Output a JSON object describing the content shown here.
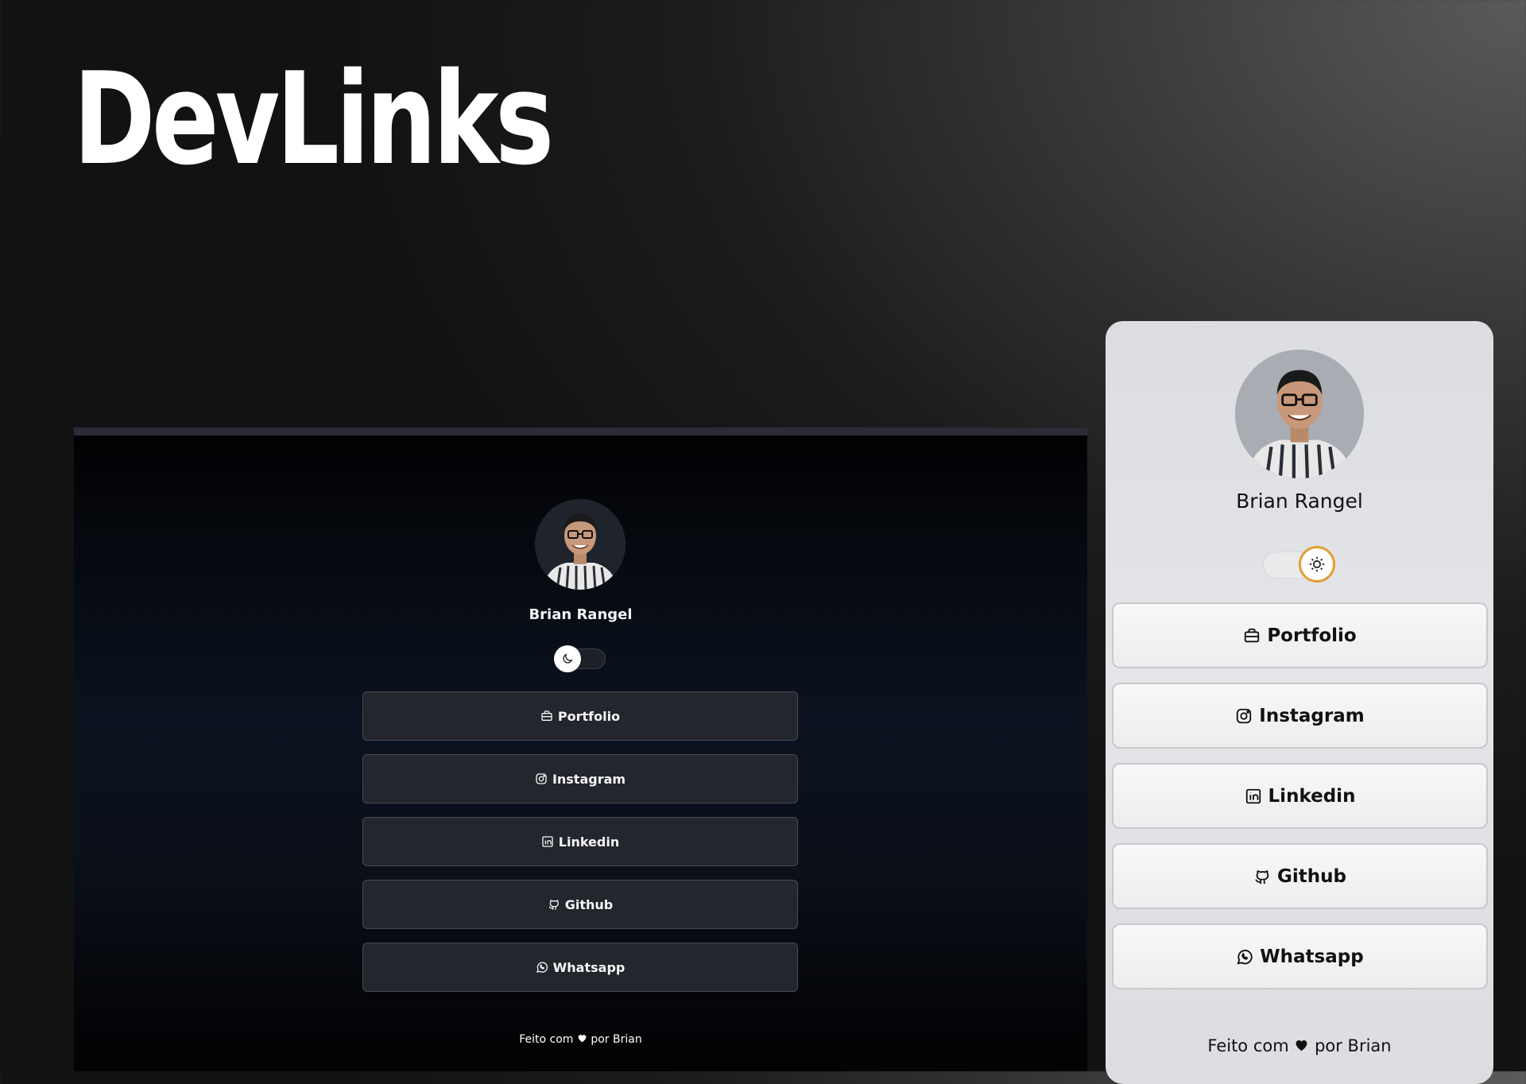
{
  "hero": {
    "title": "DevLinks"
  },
  "profile": {
    "name": "Brian Rangel"
  },
  "links": [
    {
      "label": "Portfolio",
      "icon": "briefcase-icon"
    },
    {
      "label": "Instagram",
      "icon": "instagram-icon"
    },
    {
      "label": "Linkedin",
      "icon": "linkedin-icon"
    },
    {
      "label": "Github",
      "icon": "github-icon"
    },
    {
      "label": "Whatsapp",
      "icon": "whatsapp-icon"
    }
  ],
  "footer": {
    "prefix": "Feito com",
    "suffix": "por Brian",
    "icon": "heart-icon"
  },
  "themes": {
    "desktop": {
      "mode": "dark",
      "toggle_icon": "moon-icon",
      "accent": "#23262d"
    },
    "mobile": {
      "mode": "light",
      "toggle_icon": "sun-icon",
      "accent": "#e0a030"
    }
  }
}
